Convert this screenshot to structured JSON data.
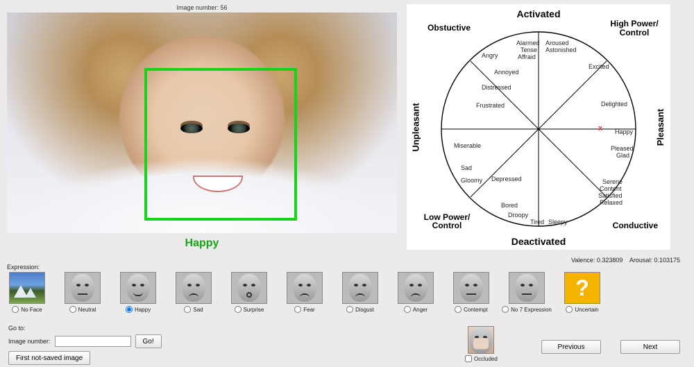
{
  "header": {
    "image_number_label": "Image number: 56"
  },
  "caption": "Happy",
  "metrics": {
    "valence_label": "Valence:",
    "valence_value": "0.323809",
    "arousal_label": "Arousal:",
    "arousal_value": "0.103175"
  },
  "circumplex": {
    "axes": {
      "top": "Activated",
      "bottom": "Deactivated",
      "left": "Unpleasant",
      "right": "Pleasant",
      "top_left": "Obstuctive",
      "top_right": "High Power/\nControl",
      "bottom_left": "Low Power/\nControl",
      "bottom_right": "Conductive"
    },
    "emotions_upper_left": [
      "Alarmed",
      "Tense",
      "Affraid",
      "Angry",
      "Annoyed",
      "Distressed",
      "Frustrated"
    ],
    "emotions_lower_left": [
      "Miserable",
      "Sad",
      "Gloomy",
      "Depressed",
      "Bored",
      "Droopy",
      "Tired",
      "Sleepy"
    ],
    "emotions_upper_right": [
      "Aroused",
      "Astonished",
      "Excited",
      "Delighted",
      "Happy"
    ],
    "emotions_lower_right": [
      "Pleased",
      "Glad",
      "Serene",
      "Content",
      "Satisfied",
      "Relaxed"
    ],
    "marker": "x"
  },
  "expression": {
    "section_label": "Expression:",
    "options": [
      {
        "key": "noface",
        "label": "No Face"
      },
      {
        "key": "neutral",
        "label": "Neutral"
      },
      {
        "key": "happy",
        "label": "Happy"
      },
      {
        "key": "sad",
        "label": "Sad"
      },
      {
        "key": "surprise",
        "label": "Surprise"
      },
      {
        "key": "fear",
        "label": "Fear"
      },
      {
        "key": "disgust",
        "label": "Disgust"
      },
      {
        "key": "anger",
        "label": "Anger"
      },
      {
        "key": "contempt",
        "label": "Contempt"
      },
      {
        "key": "no7",
        "label": "No 7 Expression"
      },
      {
        "key": "uncertain",
        "label": "Uncertain"
      }
    ],
    "selected": "happy"
  },
  "goto": {
    "title": "Go to:",
    "field_label": "Image number:",
    "go_label": "Go!",
    "first_unsaved_label": "First not-saved image"
  },
  "occluded": {
    "label": "Occluded"
  },
  "nav": {
    "prev": "Previous",
    "next": "Next"
  },
  "icons": {
    "question": "?"
  }
}
